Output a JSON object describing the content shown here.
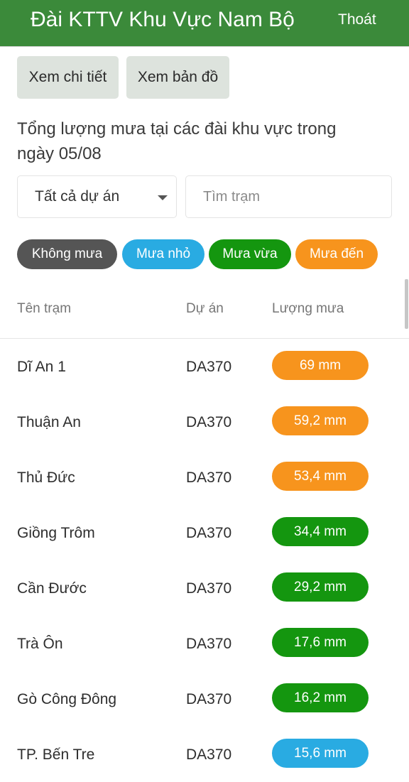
{
  "header": {
    "title": "Đài KTTV Khu Vực Nam Bộ",
    "logout_label": "Thoát"
  },
  "actions": {
    "detail_label": "Xem chi tiết",
    "map_label": "Xem bản đồ"
  },
  "summary": {
    "text": "Tổng lượng mưa tại các đài khu vực trong ngày 05/08"
  },
  "filters": {
    "project_selected": "Tất cả dự án",
    "search_placeholder": "Tìm trạm"
  },
  "legend": {
    "none": "Không mưa",
    "light": "Mưa nhỏ",
    "moderate": "Mưa vừa",
    "heavy": "Mưa đến"
  },
  "colors": {
    "header": "#3b8a3a",
    "none": "#555555",
    "light": "#29abe2",
    "moderate": "#14960f",
    "heavy": "#f7941d"
  },
  "table": {
    "columns": {
      "name": "Tên trạm",
      "project": "Dự án",
      "rainfall": "Lượng mưa"
    },
    "rows": [
      {
        "name": "Dĩ An 1",
        "project": "DA370",
        "rainfall": "69 mm",
        "level": "heavy"
      },
      {
        "name": "Thuận An",
        "project": "DA370",
        "rainfall": "59,2 mm",
        "level": "heavy"
      },
      {
        "name": "Thủ Đức",
        "project": "DA370",
        "rainfall": "53,4 mm",
        "level": "heavy"
      },
      {
        "name": "Giồng Trôm",
        "project": "DA370",
        "rainfall": "34,4 mm",
        "level": "moderate"
      },
      {
        "name": "Cần Đước",
        "project": "DA370",
        "rainfall": "29,2 mm",
        "level": "moderate"
      },
      {
        "name": "Trà Ôn",
        "project": "DA370",
        "rainfall": "17,6 mm",
        "level": "moderate"
      },
      {
        "name": "Gò Công Đông",
        "project": "DA370",
        "rainfall": "16,2 mm",
        "level": "moderate"
      },
      {
        "name": "TP. Bến Tre",
        "project": "DA370",
        "rainfall": "15,6 mm",
        "level": "light"
      }
    ]
  }
}
